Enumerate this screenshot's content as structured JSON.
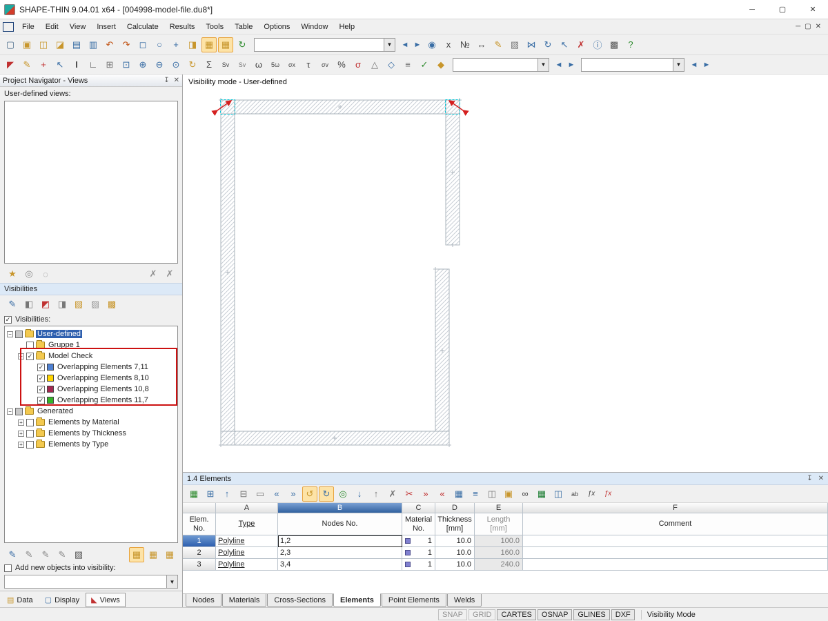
{
  "colors": {
    "selection": "#2e5fae",
    "panel-header": "#dce9f7",
    "annotation": "#cc1111",
    "material": "#8080d0",
    "hatch": "#c9cfd6",
    "outline": "#a9b3bb",
    "marker-cyan": "#00c8d8",
    "marker-red": "#d42020",
    "grid-line": "#b9c2cb"
  },
  "window": {
    "title": "SHAPE-THIN 9.04.01 x64 - [004998-model-file.du8*]",
    "minimize": "─",
    "maximize": "▢",
    "close": "✕"
  },
  "menu": {
    "items": [
      {
        "label": "File"
      },
      {
        "label": "Edit"
      },
      {
        "label": "View"
      },
      {
        "label": "Insert"
      },
      {
        "label": "Calculate"
      },
      {
        "label": "Results"
      },
      {
        "label": "Tools"
      },
      {
        "label": "Table"
      },
      {
        "label": "Options"
      },
      {
        "label": "Window"
      },
      {
        "label": "Help"
      }
    ],
    "mdi_minimize": "─",
    "mdi_restore": "▢",
    "mdi_close": "✕"
  },
  "toolbar1": {
    "icons_left": [
      {
        "name": "new-file-icon",
        "glyph": "▢",
        "style": "color:#4a6b8a"
      },
      {
        "name": "open-file-icon",
        "glyph": "▣",
        "style": "color:#c8962c"
      },
      {
        "name": "save-icon",
        "glyph": "◫",
        "style": "color:#c8962c"
      },
      {
        "name": "save-copy-icon",
        "glyph": "◪",
        "style": "color:#c8962c"
      },
      {
        "name": "print-icon",
        "glyph": "▤",
        "style": "color:#3a6ea5"
      },
      {
        "name": "print-preview-icon",
        "glyph": "▥",
        "style": "color:#3a6ea5"
      },
      {
        "name": "undo-icon",
        "glyph": "↶",
        "style": "color:#c05010"
      },
      {
        "name": "redo-icon",
        "glyph": "↷",
        "style": "color:#c05010"
      },
      {
        "name": "zoom-window-icon",
        "glyph": "◻",
        "style": "color:#3a6ea5"
      },
      {
        "name": "zoom-icon",
        "glyph": "○",
        "style": "color:#3a6ea5"
      },
      {
        "name": "pan-icon",
        "glyph": "+",
        "style": "color:#3a6ea5"
      },
      {
        "name": "navigator-icon",
        "glyph": "◨",
        "style": "color:#c8962c"
      },
      {
        "name": "tables-icon",
        "glyph": "▦",
        "style": "color:#c8962c",
        "pressed": "true"
      },
      {
        "name": "table-series-icon",
        "glyph": "▦",
        "style": "color:#c8962c",
        "pressed": "true"
      },
      {
        "name": "refresh-icon",
        "glyph": "↻",
        "style": "color:#2e8b2e"
      }
    ],
    "combo_value": "",
    "back": "◄",
    "forward": "►",
    "icons_right": [
      {
        "name": "go-to-graphic-icon",
        "glyph": "◉",
        "style": "color:#3a6ea5"
      },
      {
        "name": "coordinate-xyz-icon",
        "glyph": "x",
        "style": "color:#444"
      },
      {
        "name": "numbering-icon",
        "glyph": "№",
        "style": "color:#444"
      },
      {
        "name": "dimension-icon",
        "glyph": "↔",
        "style": "color:#444"
      },
      {
        "name": "comment-icon",
        "glyph": "✎",
        "style": "color:#c8962c"
      },
      {
        "name": "hatching-icon",
        "glyph": "▨",
        "style": "color:#777"
      },
      {
        "name": "mirror-icon",
        "glyph": "⋈",
        "style": "color:#3a6ea5"
      },
      {
        "name": "rotate-icon",
        "glyph": "↻",
        "style": "color:#3a6ea5"
      },
      {
        "name": "move-icon",
        "glyph": "↖",
        "style": "color:#3a6ea5"
      },
      {
        "name": "delete-icon",
        "glyph": "✗",
        "style": "color:#c03030"
      },
      {
        "name": "info-icon",
        "glyph": "ⓘ",
        "style": "color:#3a6ea5"
      },
      {
        "name": "render-icon",
        "glyph": "▩",
        "style": "color:#555"
      },
      {
        "name": "help-icon",
        "glyph": "?",
        "style": "color:#2e8b2e"
      }
    ]
  },
  "toolbar2": {
    "icons": [
      {
        "name": "select-icon",
        "glyph": "◤",
        "style": "color:#c03030"
      },
      {
        "name": "edit-pencil-icon",
        "glyph": "✎",
        "style": "color:#c8962c"
      },
      {
        "name": "node-tool-icon",
        "glyph": "+",
        "style": "color:#c03030"
      },
      {
        "name": "move-node-icon",
        "glyph": "↖",
        "style": "color:#3a6ea5"
      },
      {
        "name": "insert-element-icon",
        "glyph": "I",
        "style": "color:#444;font-weight:bold"
      },
      {
        "name": "polyline-icon",
        "glyph": "∟",
        "style": "color:#444"
      },
      {
        "name": "grid-settings-icon",
        "glyph": "⊞",
        "style": "color:#777"
      },
      {
        "name": "select-window-icon",
        "glyph": "⊡",
        "style": "color:#3a6ea5"
      },
      {
        "name": "zoom-in-icon",
        "glyph": "⊕",
        "style": "color:#3a6ea5"
      },
      {
        "name": "zoom-out-icon",
        "glyph": "⊖",
        "style": "color:#3a6ea5"
      },
      {
        "name": "zoom-all-icon",
        "glyph": "⊙",
        "style": "color:#3a6ea5"
      },
      {
        "name": "rotate-view-icon",
        "glyph": "↻",
        "style": "color:#c8962c"
      },
      {
        "name": "sum-icon",
        "glyph": "Σ",
        "style": "color:#444"
      },
      {
        "name": "stress-sv-icon",
        "glyph": "Sv",
        "style": "color:#444;font-size:9px"
      },
      {
        "name": "stress-sv2-icon",
        "glyph": "Sv",
        "style": "color:#777;font-size:9px"
      },
      {
        "name": "omega-icon",
        "glyph": "ω",
        "style": "color:#444"
      },
      {
        "name": "omega5-icon",
        "glyph": "5ω",
        "style": "color:#444;font-size:9px"
      },
      {
        "name": "sigma-x-icon",
        "glyph": "σx",
        "style": "color:#444;font-size:9px"
      },
      {
        "name": "tau-icon",
        "glyph": "τ",
        "style": "color:#444"
      },
      {
        "name": "sigma-v-icon",
        "glyph": "σv",
        "style": "color:#444;font-size:9px"
      },
      {
        "name": "percent-icon",
        "glyph": "%",
        "style": "color:#444"
      },
      {
        "name": "sigma-pl-icon",
        "glyph": "σ",
        "style": "color:#c03030"
      },
      {
        "name": "weld-icon",
        "glyph": "△",
        "style": "color:#777"
      },
      {
        "name": "diagram-icon",
        "glyph": "◇",
        "style": "color:#3a6ea5"
      },
      {
        "name": "result-list-icon",
        "glyph": "≡",
        "style": "color:#777"
      },
      {
        "name": "check-icon",
        "glyph": "✓",
        "style": "color:#2e8b2e"
      },
      {
        "name": "color-palette-icon",
        "glyph": "◆",
        "style": "color:#c8962c"
      }
    ],
    "combo1_value": "",
    "combo2_value": "",
    "back": "◄",
    "forward": "►"
  },
  "navigator": {
    "title": "Project Navigator - Views",
    "pin": "↧",
    "close": "✕",
    "views_label": "User-defined views:",
    "views_toolbar": [
      {
        "name": "new-view-button",
        "glyph": "★",
        "style": "color:#c8962c"
      },
      {
        "name": "assign-view-button",
        "glyph": "◎",
        "style": "color:#888"
      },
      {
        "name": "link-view-button",
        "glyph": "◌",
        "style": "color:#888"
      }
    ],
    "views_toolbar_right": [
      {
        "name": "pin-view-button",
        "glyph": "✗",
        "style": "color:#909090"
      },
      {
        "name": "unpin-view-button",
        "glyph": "✗",
        "style": "color:#909090"
      }
    ],
    "visibilities_header": "Visibilities",
    "vis_toolbar": [
      {
        "name": "visibility-new-button",
        "glyph": "✎",
        "style": "color:#3a6ea5"
      },
      {
        "name": "visibility-window-button",
        "glyph": "◧",
        "style": "color:#777"
      },
      {
        "name": "visibility-invert-button",
        "glyph": "◩",
        "style": "color:#c03030"
      },
      {
        "name": "visibility-criterion-button",
        "glyph": "◨",
        "style": "color:#777"
      },
      {
        "name": "visibility-show-all-button",
        "glyph": "▧",
        "style": "color:#c8962c"
      },
      {
        "name": "visibility-hide-button",
        "glyph": "▨",
        "style": "color:#999"
      },
      {
        "name": "visibility-reset-button",
        "glyph": "▩",
        "style": "color:#c8962c"
      }
    ],
    "visibilities_checkbox": "Visibilities:",
    "tree": [
      {
        "label": "User-defined",
        "level": "0",
        "expander": "minus",
        "check": "partial",
        "icon": "folder",
        "selected": "true"
      },
      {
        "label": "Gruppe 1",
        "level": "1",
        "expander": "none",
        "check": "unchecked",
        "icon": "folder"
      },
      {
        "label": "Model Check",
        "level": "1",
        "expander": "minus",
        "check": "checked",
        "icon": "folder"
      },
      {
        "label": "Overlapping Elements 7,11",
        "level": "2",
        "expander": "none",
        "check": "checked",
        "icon": "color",
        "iconStyle": "background:#4f81d2"
      },
      {
        "label": "Overlapping Elements 8,10",
        "level": "2",
        "expander": "none",
        "check": "checked",
        "icon": "color",
        "iconStyle": "background:#ffd400"
      },
      {
        "label": "Overlapping Elements 10,8",
        "level": "2",
        "expander": "none",
        "check": "checked",
        "icon": "color",
        "iconStyle": "background:#a42850"
      },
      {
        "label": "Overlapping Elements 11,7",
        "level": "2",
        "expander": "none",
        "check": "checked",
        "icon": "color",
        "iconStyle": "background:#36b428"
      },
      {
        "label": "Generated",
        "level": "0",
        "expander": "minus",
        "check": "partial",
        "icon": "folder"
      },
      {
        "label": "Elements by Material",
        "level": "1",
        "expander": "plus",
        "check": "unchecked",
        "icon": "folder"
      },
      {
        "label": "Elements by Thickness",
        "level": "1",
        "expander": "plus",
        "check": "unchecked",
        "icon": "folder"
      },
      {
        "label": "Elements by Type",
        "level": "1",
        "expander": "plus",
        "check": "unchecked",
        "icon": "folder"
      }
    ],
    "bottom_toolbar": [
      {
        "name": "new-user-view-button",
        "glyph": "✎",
        "style": "color:#3a6ea5"
      },
      {
        "name": "edit-view-button",
        "glyph": "✎",
        "style": "color:#888"
      },
      {
        "name": "delete-view-button",
        "glyph": "✎",
        "style": "color:#888"
      },
      {
        "name": "special-view-button",
        "glyph": "✎",
        "style": "color:#888"
      },
      {
        "name": "settings-view-button",
        "glyph": "▨",
        "style": "color:#555"
      }
    ],
    "bottom_toolbar_right": [
      {
        "name": "window-arrangement-1-button",
        "glyph": "▦",
        "style": "color:#c8962c",
        "pressed": "true"
      },
      {
        "name": "window-arrangement-2-button",
        "glyph": "▦",
        "style": "color:#c8962c"
      },
      {
        "name": "window-arrangement-3-button",
        "glyph": "▦",
        "style": "color:#c8962c"
      }
    ],
    "add_new_label": "Add new objects into visibility:",
    "add_new_combo_value": "",
    "tabs": [
      {
        "label": "Data",
        "glyph": "▤",
        "style": "color:#c8962c"
      },
      {
        "label": "Display",
        "glyph": "▢",
        "style": "color:#3a6ea5"
      },
      {
        "label": "Views",
        "glyph": "◣",
        "style": "color:#c03030",
        "active": "true"
      }
    ]
  },
  "canvas": {
    "mode_label": "Visibility mode - User-defined"
  },
  "table_panel": {
    "title": "1.4 Elements",
    "pin": "↧",
    "close": "✕",
    "toolbar": [
      {
        "name": "table-check-icon",
        "glyph": "▦",
        "style": "color:#2e8b2e"
      },
      {
        "name": "expand-table-icon",
        "glyph": "⊞",
        "style": "color:#3a6ea5"
      },
      {
        "name": "row-up-icon",
        "glyph": "↑",
        "style": "color:#3a6ea5"
      },
      {
        "name": "row-new-icon",
        "glyph": "⊟",
        "style": "color:#777"
      },
      {
        "name": "clear-row-icon",
        "glyph": "▭",
        "style": "color:#777"
      },
      {
        "name": "go-first-icon",
        "glyph": "«",
        "style": "color:#3a6ea5"
      },
      {
        "name": "go-last-icon",
        "glyph": "»",
        "style": "color:#3a6ea5"
      },
      {
        "name": "undo-table-icon",
        "glyph": "↺",
        "style": "color:#c8962c",
        "pressed": "true"
      },
      {
        "name": "redo-table-icon",
        "glyph": "↻",
        "style": "color:#3a6ea5",
        "pressed": "true"
      },
      {
        "name": "globe-icon",
        "glyph": "◎",
        "style": "color:#2e8b2e"
      },
      {
        "name": "arrow-down-icon",
        "glyph": "↓",
        "style": "color:#3a6ea5"
      },
      {
        "name": "arrow-up-icon",
        "glyph": "↑",
        "style": "color:#777"
      },
      {
        "name": "deactivate-icon",
        "glyph": "✗",
        "style": "color:#777"
      },
      {
        "name": "delete-rows-icon",
        "glyph": "✂",
        "style": "color:#c03030"
      },
      {
        "name": "insert-rows-icon",
        "glyph": "»",
        "style": "color:#c03030"
      },
      {
        "name": "move-rows-icon",
        "glyph": "«",
        "style": "color:#c03030"
      },
      {
        "name": "view-grid-icon",
        "glyph": "▦",
        "style": "color:#3a6ea5"
      },
      {
        "name": "view-list-icon",
        "glyph": "≡",
        "style": "color:#3a6ea5"
      },
      {
        "name": "filter-icon",
        "glyph": "◫",
        "style": "color:#777"
      },
      {
        "name": "export-picture-icon",
        "glyph": "▣",
        "style": "color:#c8962c"
      },
      {
        "name": "spectacles-icon",
        "glyph": "∞",
        "style": "color:#444"
      },
      {
        "name": "excel-export-icon",
        "glyph": "▦",
        "style": "color:#1e7e34"
      },
      {
        "name": "ole-export-icon",
        "glyph": "◫",
        "style": "color:#3a6ea5"
      },
      {
        "name": "spell-check-icon",
        "glyph": "ab",
        "style": "color:#444;font-size:9px"
      },
      {
        "name": "function-icon",
        "glyph": "ƒx",
        "style": "color:#444;font-size:10px;font-style:italic"
      },
      {
        "name": "function-delete-icon",
        "glyph": "ƒx",
        "style": "color:#c03030;font-size:10px;font-style:italic"
      }
    ],
    "letters": [
      "A",
      "B",
      "C",
      "D",
      "E",
      "F"
    ],
    "headers": {
      "no1": "Elem.",
      "no2": "No.",
      "type": "Type",
      "nodes": "Nodes No.",
      "mat1": "Material",
      "mat2": "No.",
      "th1": "Thickness",
      "th2": "[mm]",
      "len1": "Length",
      "len2": "[mm]",
      "comment": "Comment"
    },
    "rows": [
      {
        "no": "1",
        "type": "Polyline",
        "nodes": "1,2",
        "material": "1",
        "thickness": "10.0",
        "length": "100.0",
        "comment": "",
        "selected": "true",
        "editing": "true"
      },
      {
        "no": "2",
        "type": "Polyline",
        "nodes": "2,3",
        "material": "1",
        "thickness": "10.0",
        "length": "160.0",
        "comment": ""
      },
      {
        "no": "3",
        "type": "Polyline",
        "nodes": "3,4",
        "material": "1",
        "thickness": "10.0",
        "length": "240.0",
        "comment": ""
      }
    ],
    "tabs": [
      {
        "label": "Nodes"
      },
      {
        "label": "Materials"
      },
      {
        "label": "Cross-Sections"
      },
      {
        "label": "Elements",
        "active": "true"
      },
      {
        "label": "Point Elements"
      },
      {
        "label": "Welds"
      }
    ]
  },
  "statusbar": {
    "boxes": [
      {
        "label": "SNAP",
        "on": "false"
      },
      {
        "label": "GRID",
        "on": "false"
      },
      {
        "label": "CARTES",
        "on": "true"
      },
      {
        "label": "OSNAP",
        "on": "true"
      },
      {
        "label": "GLINES",
        "on": "true"
      },
      {
        "label": "DXF",
        "on": "true"
      }
    ],
    "mode": "Visibility Mode"
  }
}
